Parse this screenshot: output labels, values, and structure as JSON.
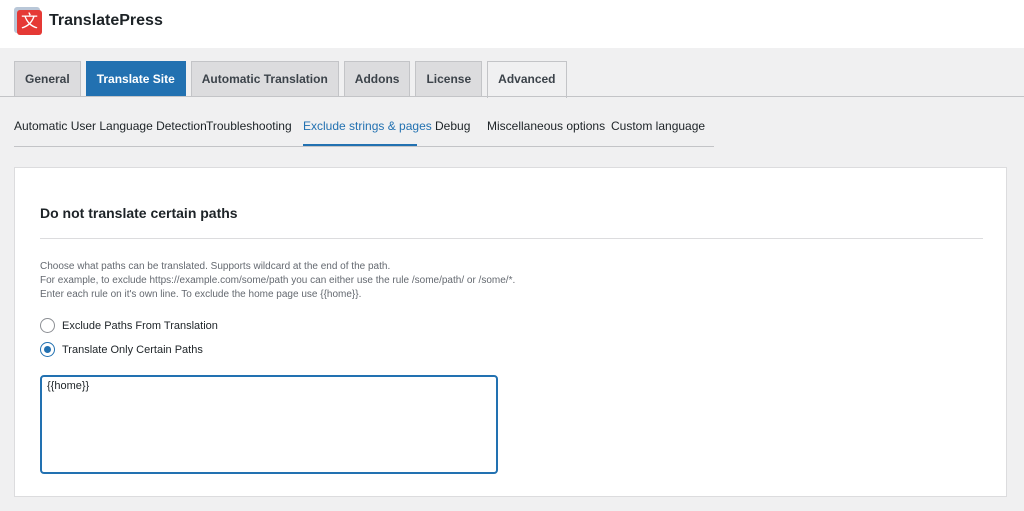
{
  "header": {
    "brand": "TranslatePress",
    "logo_glyph": "文"
  },
  "tabs": [
    {
      "label": "General"
    },
    {
      "label": "Translate Site"
    },
    {
      "label": "Automatic Translation"
    },
    {
      "label": "Addons"
    },
    {
      "label": "License"
    },
    {
      "label": "Advanced"
    }
  ],
  "subnav": [
    {
      "label": "Automatic User Language Detection"
    },
    {
      "label": "Troubleshooting"
    },
    {
      "label": "Exclude strings & pages"
    },
    {
      "label": "Debug"
    },
    {
      "label": "Miscellaneous options"
    },
    {
      "label": "Custom language"
    }
  ],
  "panel": {
    "title": "Do not translate certain paths",
    "desc": [
      "Choose what paths can be translated. Supports wildcard at the end of the path.",
      "For example, to exclude https://example.com/some/path you can either use the rule /some/path/ or /some/*.",
      "Enter each rule on it's own line. To exclude the home page use {{home}}."
    ],
    "options": [
      {
        "label": "Exclude Paths From Translation",
        "checked": false
      },
      {
        "label": "Translate Only Certain Paths",
        "checked": true
      }
    ],
    "paths_value": "{{home}}"
  },
  "colors": {
    "accent": "#2271b1",
    "logo_red": "#e53935"
  }
}
